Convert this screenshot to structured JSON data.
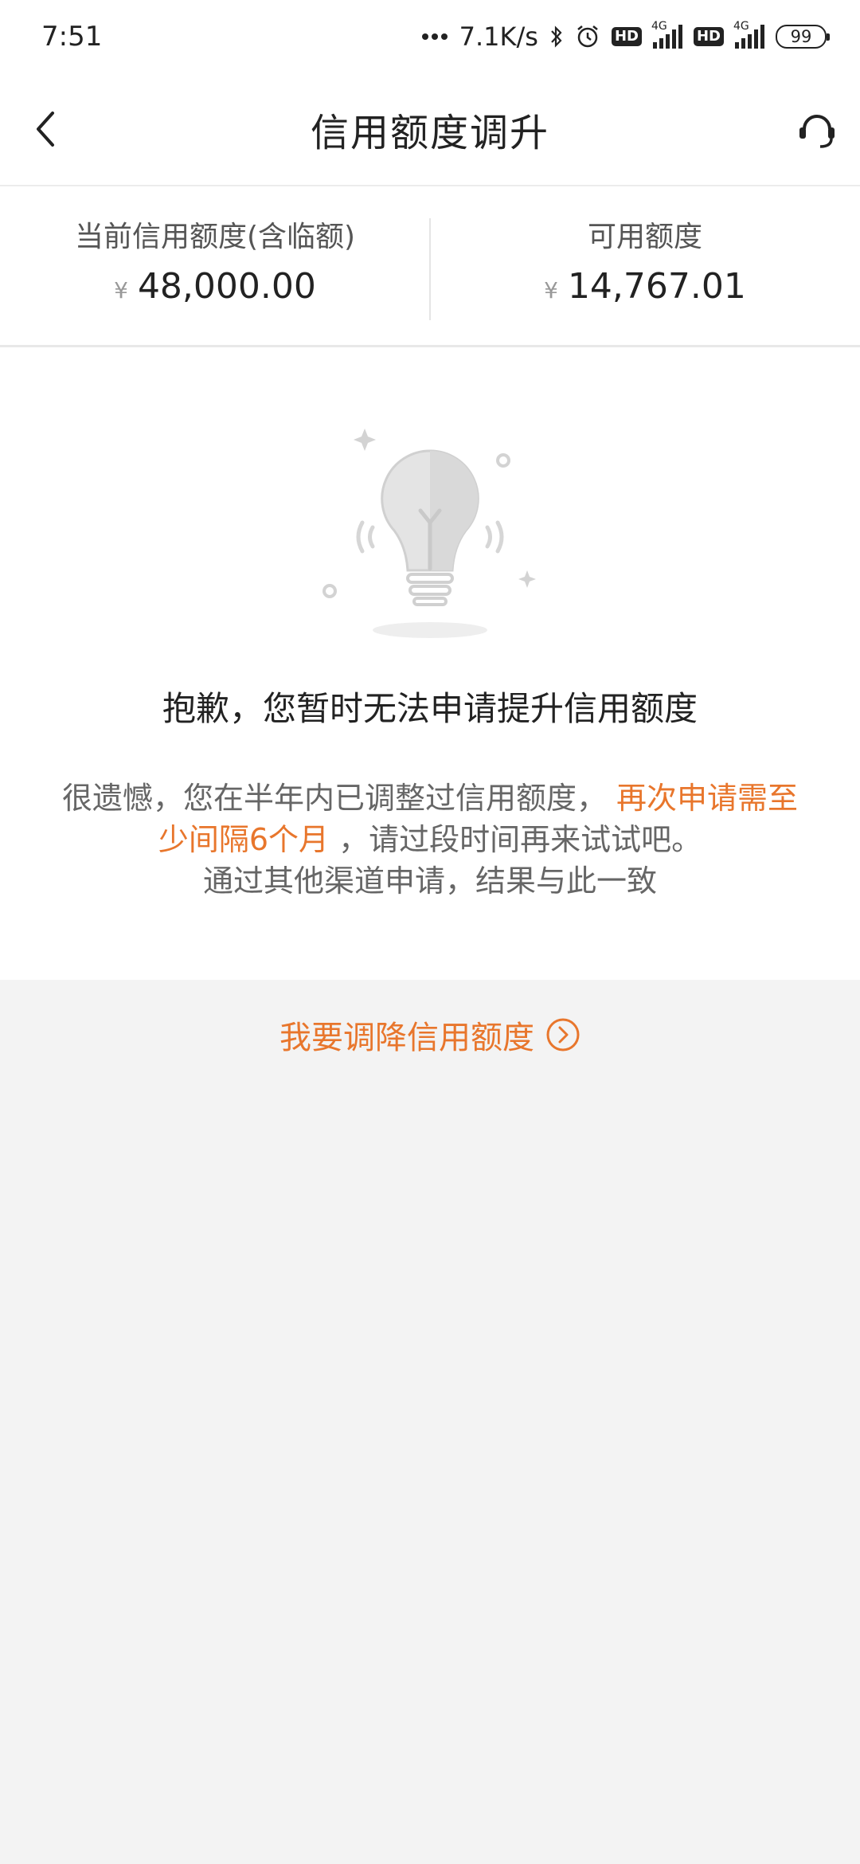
{
  "status_bar": {
    "time": "7:51",
    "network_speed": "7.1K/s",
    "hd_label": "HD",
    "network_type": "4G",
    "battery": "99",
    "icons": [
      "more-dots-icon",
      "bluetooth-icon",
      "alarm-icon",
      "hd-icon",
      "signal-icon",
      "battery-icon"
    ]
  },
  "nav": {
    "title": "信用额度调升",
    "icons": [
      "back-arrow-icon",
      "customer-service-icon"
    ]
  },
  "credit": {
    "current_label": "当前信用额度(含临额)",
    "current_currency": "¥",
    "current_value": "48,000.00",
    "available_label": "可用额度",
    "available_currency": "¥",
    "available_value": "14,767.01"
  },
  "result": {
    "title": "抱歉，您暂时无法申请提升信用额度",
    "message_part1": "很遗憾，您在半年内已调整过信用额度，",
    "message_highlight": "再次申请需至少间隔6个月",
    "message_part2": "，请过段时间再来试试吧。",
    "message_line3": "通过其他渠道申请，结果与此一致"
  },
  "actions": {
    "lower_limit_label": "我要调降信用额度"
  },
  "colors": {
    "accent": "#e8762c",
    "background": "#f3f3f3",
    "card": "#ffffff"
  }
}
